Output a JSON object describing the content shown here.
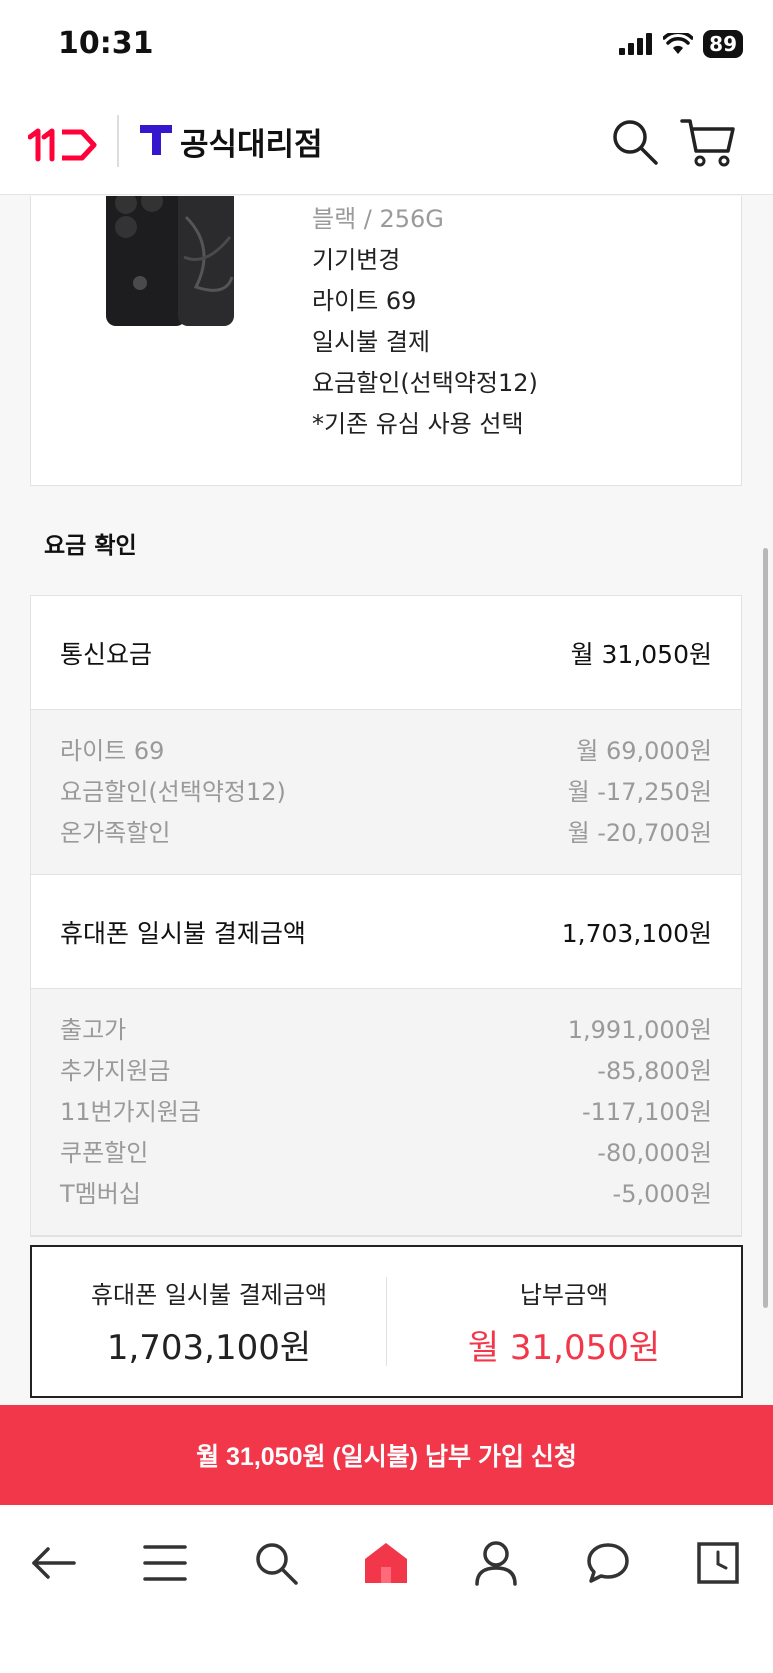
{
  "status_bar": {
    "time": "10:31",
    "battery": "89"
  },
  "header": {
    "brand": "공식대리점"
  },
  "product": {
    "color": "블랙 / 256G",
    "options": [
      "기기변경",
      "라이트 69",
      "일시불 결제",
      "요금할인(선택약정12)",
      "*기존 유심 사용 선택"
    ]
  },
  "fee_section": {
    "title": "요금 확인",
    "telecom": {
      "label": "통신요금",
      "value": "월 31,050원",
      "details": [
        {
          "label": "라이트 69",
          "value": "월 69,000원"
        },
        {
          "label": "요금할인(선택약정12)",
          "value": "월 -17,250원"
        },
        {
          "label": "온가족할인",
          "value": "월 -20,700원"
        }
      ]
    },
    "device": {
      "label": "휴대폰 일시불 결제금액",
      "value": "1,703,100원",
      "details": [
        {
          "label": "출고가",
          "value": "1,991,000원"
        },
        {
          "label": "추가지원금",
          "value": "-85,800원"
        },
        {
          "label": "11번가지원금",
          "value": "-117,100원"
        },
        {
          "label": "쿠폰할인",
          "value": "-80,000원"
        },
        {
          "label": "T멤버십",
          "value": "-5,000원"
        }
      ]
    }
  },
  "summary": {
    "device_label": "휴대폰 일시불 결제금액",
    "device_value": "1,703,100원",
    "payment_label": "납부금액",
    "payment_value": "월 31,050원"
  },
  "cta": {
    "label": "월 31,050원 (일시불) 납부 가입 신청"
  },
  "bottom_nav": {
    "items": [
      "back-icon",
      "menu-icon",
      "search-icon",
      "home-icon",
      "profile-icon",
      "chat-icon",
      "history-icon"
    ]
  },
  "colors": {
    "accent": "#f2374a",
    "brand_t": "#3617ce",
    "brand_11": "#ff0038"
  }
}
